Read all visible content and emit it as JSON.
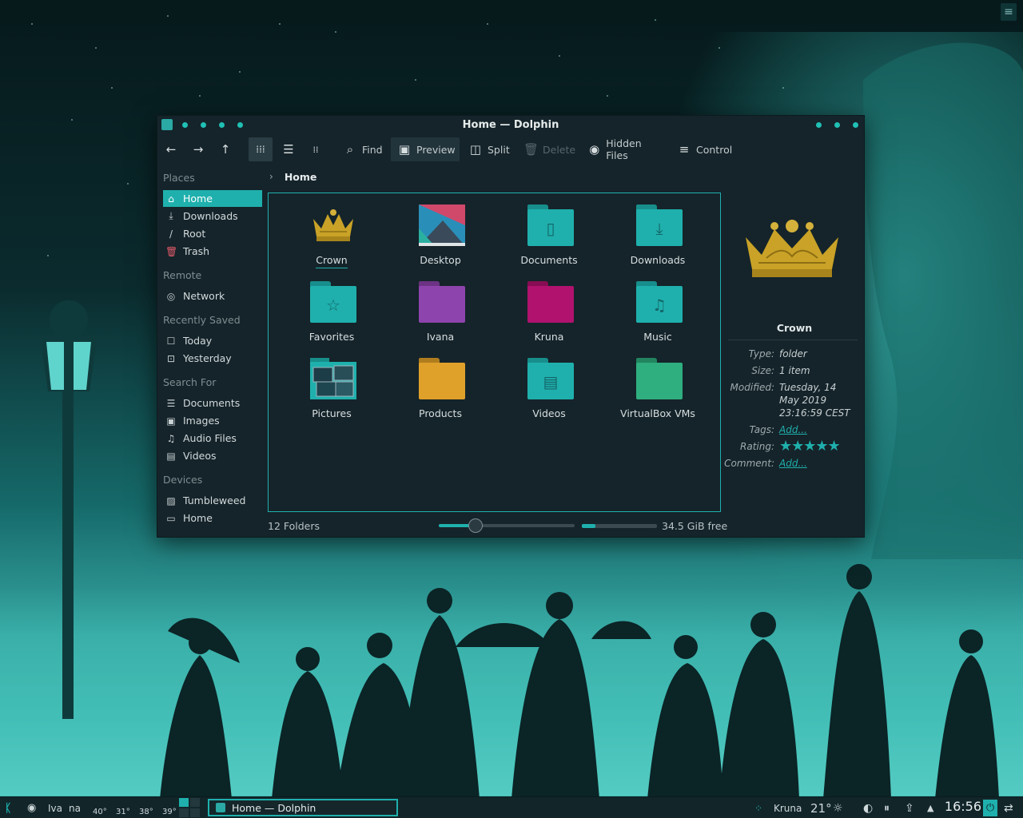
{
  "window": {
    "title": "Home — Dolphin"
  },
  "toolbar": {
    "find": "Find",
    "preview": "Preview",
    "split": "Split",
    "delete": "Delete",
    "hidden_files": "Hidden Files",
    "control": "Control"
  },
  "sidebar": {
    "places_title": "Places",
    "places": [
      "Home",
      "Downloads",
      "Root",
      "Trash"
    ],
    "remote_title": "Remote",
    "remote": [
      "Network"
    ],
    "recent_title": "Recently Saved",
    "recent": [
      "Today",
      "Yesterday"
    ],
    "search_title": "Search For",
    "search": [
      "Documents",
      "Images",
      "Audio Files",
      "Videos"
    ],
    "devices_title": "Devices",
    "devices": [
      "Tumbleweed",
      "Home"
    ]
  },
  "breadcrumb": {
    "current": "Home"
  },
  "files": [
    {
      "name": "Crown",
      "icon": "crown-icon"
    },
    {
      "name": "Desktop",
      "icon": "desktop-folder-icon"
    },
    {
      "name": "Documents",
      "icon": "documents-folder-icon",
      "color": "#1fb0ad"
    },
    {
      "name": "Downloads",
      "icon": "downloads-folder-icon",
      "color": "#1fb0ad"
    },
    {
      "name": "Favorites",
      "icon": "favorites-folder-icon",
      "color": "#1fb0ad"
    },
    {
      "name": "Ivana",
      "icon": "folder-icon",
      "color": "#8e44ad"
    },
    {
      "name": "Kruna",
      "icon": "folder-icon",
      "color": "#b0126e"
    },
    {
      "name": "Music",
      "icon": "music-folder-icon",
      "color": "#1fb0ad"
    },
    {
      "name": "Pictures",
      "icon": "pictures-folder-icon"
    },
    {
      "name": "Products",
      "icon": "folder-icon",
      "color": "#e0a12a"
    },
    {
      "name": "Videos",
      "icon": "videos-folder-icon",
      "color": "#1fb0ad"
    },
    {
      "name": "VirtualBox VMs",
      "icon": "folder-icon",
      "color": "#2fae7f"
    }
  ],
  "statusbar": {
    "count": "12 Folders",
    "free": "34.5 GiB free",
    "zoom_fraction": 0.27,
    "used_fraction": 0.18
  },
  "info": {
    "name": "Crown",
    "type_label": "Type:",
    "type_value": "folder",
    "size_label": "Size:",
    "size_value": "1 item",
    "modified_label": "Modified:",
    "modified_value": "Tuesday, 14 May 2019 23:16:59 CEST",
    "tags_label": "Tags:",
    "tags_value": "Add...",
    "rating_label": "Rating:",
    "rating_value": "★★★★★",
    "comment_label": "Comment:",
    "comment_value": "Add..."
  },
  "taskbar": {
    "user1": "Iva",
    "user2": "na",
    "temps": [
      "40°",
      "31°",
      "38°",
      "39°"
    ],
    "task": "Home — Dolphin",
    "city": "Kruna",
    "weather_temp": "21°",
    "time": "16:56"
  },
  "colors": {
    "accent": "#1fb0ad",
    "window_bg": "#15242a"
  }
}
